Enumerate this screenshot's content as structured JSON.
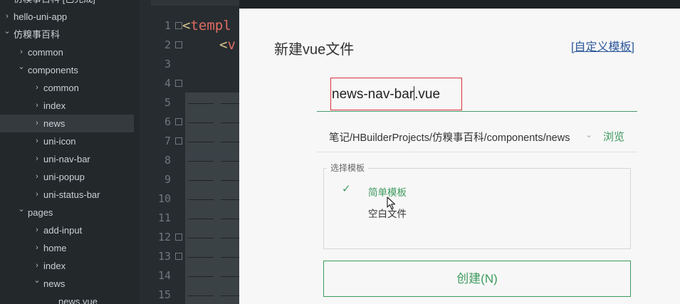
{
  "sidebar": {
    "items": [
      {
        "label": "仿糗事百科 [已完成]",
        "level": 0,
        "expanded": false
      },
      {
        "label": "hello-uni-app",
        "level": 0,
        "expanded": false
      },
      {
        "label": "仿糗事百科",
        "level": 0,
        "expanded": true
      },
      {
        "label": "common",
        "level": 1,
        "expanded": false
      },
      {
        "label": "components",
        "level": 1,
        "expanded": true
      },
      {
        "label": "common",
        "level": 2,
        "expanded": false
      },
      {
        "label": "index",
        "level": 2,
        "expanded": false
      },
      {
        "label": "news",
        "level": 2,
        "expanded": false,
        "selected": true
      },
      {
        "label": "uni-icon",
        "level": 2,
        "expanded": false
      },
      {
        "label": "uni-nav-bar",
        "level": 2,
        "expanded": false
      },
      {
        "label": "uni-popup",
        "level": 2,
        "expanded": false
      },
      {
        "label": "uni-status-bar",
        "level": 2,
        "expanded": false
      },
      {
        "label": "pages",
        "level": 1,
        "expanded": true
      },
      {
        "label": "add-input",
        "level": 2,
        "expanded": false
      },
      {
        "label": "home",
        "level": 2,
        "expanded": false
      },
      {
        "label": "index",
        "level": 2,
        "expanded": false
      },
      {
        "label": "news",
        "level": 2,
        "expanded": true
      },
      {
        "label": "news.vue",
        "level": 3,
        "file": true
      }
    ]
  },
  "editor": {
    "line_numbers": [
      "1",
      "2",
      "3",
      "4",
      "5",
      "6",
      "7",
      "8",
      "9",
      "10",
      "11",
      "12",
      "13",
      "14",
      "15"
    ],
    "folded_lines": [
      1,
      2,
      4,
      6,
      7,
      12,
      13
    ],
    "line1_bracket": "<",
    "line1_tag": "templ",
    "line2_bracket": "<",
    "line2_tag": "v",
    "colors": {
      "bracket": "#d8c690",
      "tag": "#e06c62"
    }
  },
  "dialog": {
    "title": "新建vue文件",
    "custom_template_link": "[自定义模板]",
    "filename_before_caret": "news-nav-bar",
    "filename_after_caret": ".vue",
    "path": "笔记/HBuilderProjects/仿糗事百科/components/news",
    "path_dropdown_icon": "chevron-down-icon",
    "browse_label": "浏览",
    "template_group_label": "选择模板",
    "templates": [
      {
        "label": "简单模板",
        "selected": true
      },
      {
        "label": "空白文件",
        "selected": false
      }
    ],
    "create_button_label": "创建(N)",
    "accent_color": "#3e9a5e",
    "highlight_color": "#d9343c"
  }
}
